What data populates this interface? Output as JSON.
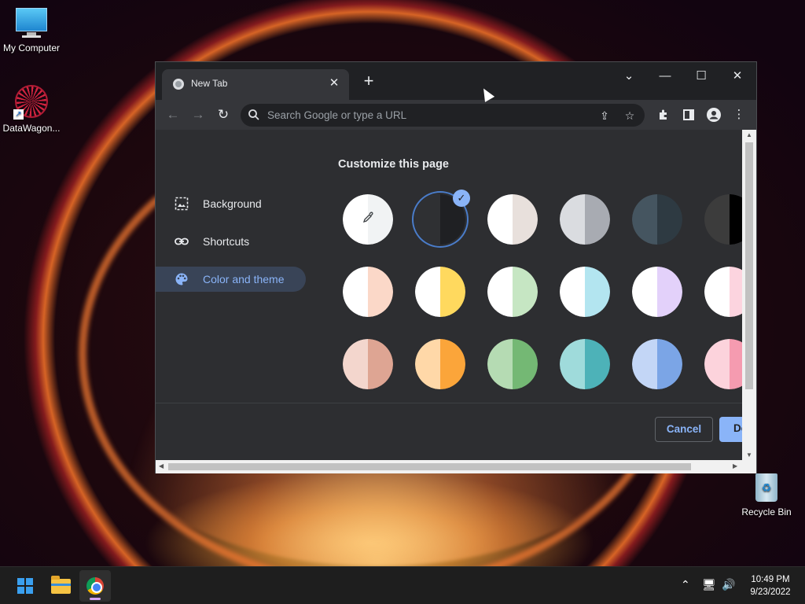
{
  "desktop": {
    "icons": [
      {
        "label": "My Computer"
      },
      {
        "label": "DataWagon..."
      },
      {
        "label": "Recycle Bin"
      }
    ]
  },
  "browser": {
    "tab": {
      "title": "New Tab"
    },
    "omnibox": {
      "placeholder": "Search Google or type a URL"
    },
    "window_controls": {
      "dropdown": "⌄",
      "minimize": "—",
      "maximize": "☐",
      "close": "✕"
    },
    "icons": {
      "back": "arrow-left-icon",
      "forward": "arrow-right-icon",
      "reload": "reload-icon",
      "share": "share-icon",
      "bookmark": "star-icon",
      "extensions": "puzzle-icon",
      "side_panel": "side-panel-icon",
      "profile": "profile-icon",
      "menu": "kebab-menu-icon"
    }
  },
  "customize": {
    "heading": "Customize this page",
    "sidebar": [
      {
        "label": "Background",
        "icon": "image-icon",
        "active": false
      },
      {
        "label": "Shortcuts",
        "icon": "link-icon",
        "active": false
      },
      {
        "label": "Color and theme",
        "icon": "palette-icon",
        "active": true
      }
    ],
    "swatches": [
      [
        {
          "name": "custom-color",
          "left": "#ffffff",
          "right": "#f1f3f4",
          "icon": "eyedropper-icon"
        },
        {
          "name": "dark-default",
          "left": "#2f3033",
          "right": "#1f2023",
          "selected": true
        },
        {
          "name": "warm-grey",
          "left": "#ffffff",
          "right": "#e8e0dc"
        },
        {
          "name": "cool-grey",
          "left": "#dadce0",
          "right": "#a8abb2"
        },
        {
          "name": "blue-grey",
          "left": "#455560",
          "right": "#2e3a42"
        },
        {
          "name": "black",
          "left": "#3c3c3c",
          "right": "#000000"
        }
      ],
      [
        {
          "name": "beige-and-white",
          "left": "#ffffff",
          "right": "#fbd8c8"
        },
        {
          "name": "yellow-and-white",
          "left": "#ffffff",
          "right": "#ffd95e"
        },
        {
          "name": "green-and-white",
          "left": "#ffffff",
          "right": "#c6e6c3"
        },
        {
          "name": "light-teal-and-white",
          "left": "#ffffff",
          "right": "#b3e5f0"
        },
        {
          "name": "light-purple-and-white",
          "left": "#ffffff",
          "right": "#e3d1fa"
        },
        {
          "name": "pink-and-white",
          "left": "#ffffff",
          "right": "#fcd4df"
        }
      ],
      [
        {
          "name": "beige",
          "left": "#f3d6cd",
          "right": "#dea593"
        },
        {
          "name": "orange",
          "left": "#ffd8a8",
          "right": "#fba53a"
        },
        {
          "name": "green",
          "left": "#b5dbb3",
          "right": "#74b874"
        },
        {
          "name": "teal",
          "left": "#9fdbdb",
          "right": "#4db2b8"
        },
        {
          "name": "light-blue",
          "left": "#c3d6f6",
          "right": "#7ba5e6"
        },
        {
          "name": "pink",
          "left": "#fcd3dc",
          "right": "#f59bb0"
        }
      ]
    ],
    "buttons": {
      "cancel": "Cancel",
      "done": "Done"
    }
  },
  "taskbar": {
    "apps": [
      "start-button",
      "file-explorer",
      "chrome"
    ],
    "clock": {
      "time": "10:49 PM",
      "date": "9/23/2022"
    }
  },
  "colors": {
    "accent": "#8ab4f8",
    "window_bg": "#202124",
    "toolbar_bg": "#35363a",
    "content_bg": "#2d2e31"
  }
}
